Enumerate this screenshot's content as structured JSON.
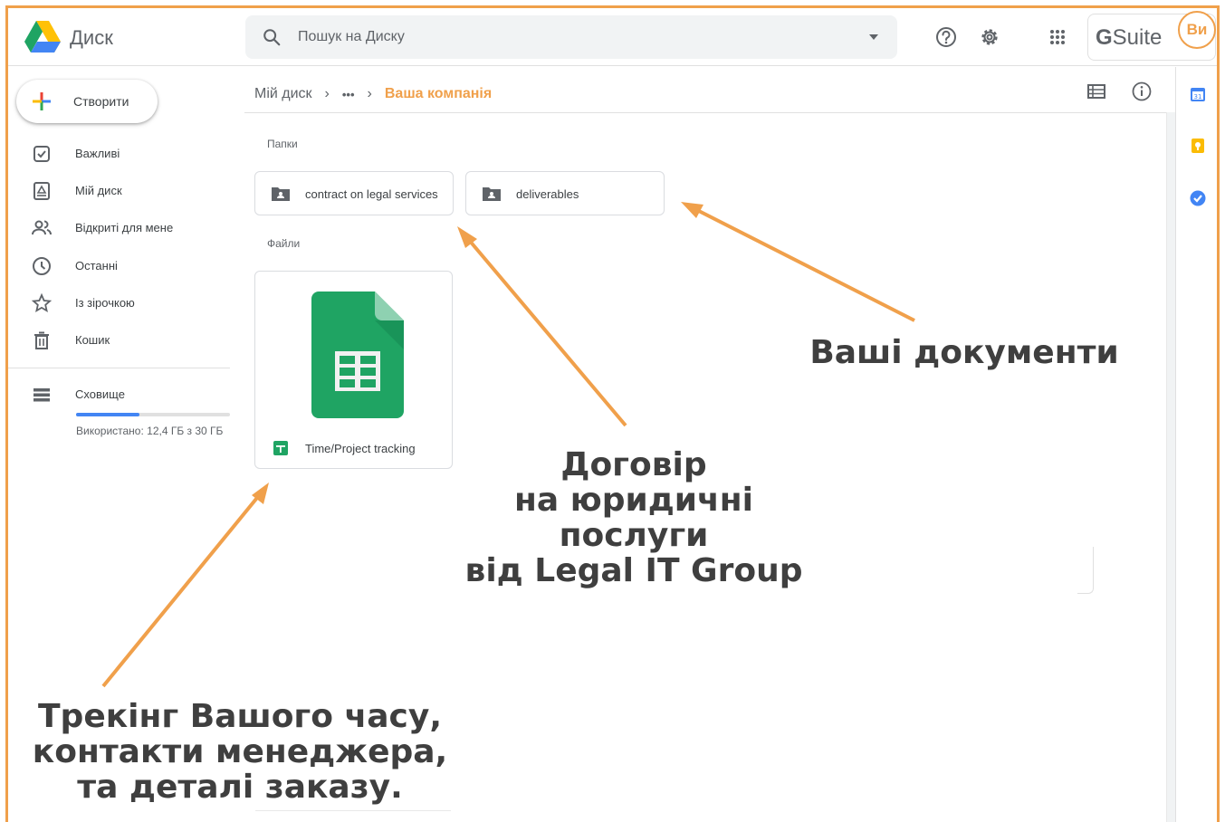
{
  "header": {
    "app_title": "Диск",
    "search_placeholder": "Пошук на Диску",
    "brand_g": "G",
    "brand_suite": "Suite",
    "avatar_initials": "Ви"
  },
  "sidebar": {
    "create_label": "Створити",
    "items": [
      {
        "label": "Важливі",
        "icon": "priority-icon"
      },
      {
        "label": "Мій диск",
        "icon": "my-drive-icon"
      },
      {
        "label": "Відкриті для мене",
        "icon": "shared-with-me-icon"
      },
      {
        "label": "Останні",
        "icon": "recent-icon"
      },
      {
        "label": "Із зірочкою",
        "icon": "star-icon"
      },
      {
        "label": "Кошик",
        "icon": "trash-icon"
      }
    ],
    "storage_label": "Сховище",
    "storage_used_text": "Використано: 12,4 ГБ з 30 ГБ",
    "storage_fraction": 0.41
  },
  "main": {
    "breadcrumb": {
      "root": "Мій диск",
      "ellipsis": "•••",
      "current": "Ваша компанія"
    },
    "folders_label": "Папки",
    "files_label": "Файли",
    "folders": [
      {
        "name": "contract on legal services"
      },
      {
        "name": "deliverables"
      }
    ],
    "files": [
      {
        "name": "Time/Project tracking"
      }
    ]
  },
  "annotations": {
    "documents": "Ваші документи",
    "contract_lines": [
      "Договір",
      "на юридичні",
      "послуги",
      "від Legal IT Group"
    ],
    "tracking_lines": [
      "Трекінг Вашого часу,",
      "контакти менеджера,",
      "та деталі заказу."
    ]
  },
  "colors": {
    "accent_orange": "#f0a04b",
    "sheets_green": "#1fa463",
    "text_dark": "#3c4043",
    "storage_blue": "#4285f4"
  }
}
